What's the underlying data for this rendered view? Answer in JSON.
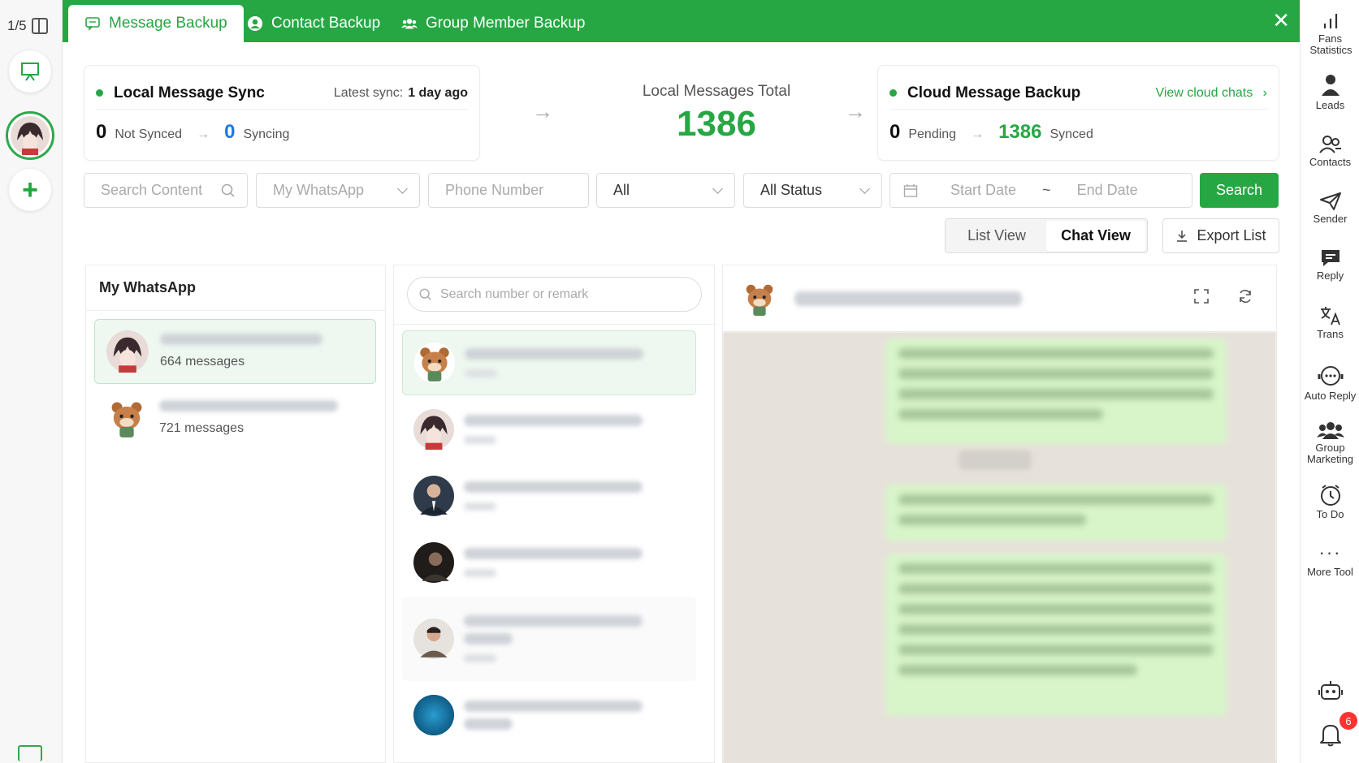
{
  "left_rail": {
    "page_count": "1/5"
  },
  "tabs": [
    {
      "label": "Message Backup",
      "active": true
    },
    {
      "label": "Contact Backup",
      "active": false
    },
    {
      "label": "Group Member Backup",
      "active": false
    }
  ],
  "local_sync": {
    "title": "Local Message Sync",
    "latest_label": "Latest sync:",
    "latest_value": "1 day ago",
    "not_synced_count": "0",
    "not_synced_label": "Not Synced",
    "syncing_count": "0",
    "syncing_label": "Syncing"
  },
  "total": {
    "label": "Local Messages Total",
    "value": "1386"
  },
  "cloud_backup": {
    "title": "Cloud Message Backup",
    "link": "View cloud chats",
    "pending_count": "0",
    "pending_label": "Pending",
    "synced_count": "1386",
    "synced_label": "Synced"
  },
  "filters": {
    "search_content_placeholder": "Search Content",
    "account_placeholder": "My WhatsApp",
    "phone_placeholder": "Phone Number",
    "type_value": "All",
    "status_value": "All Status",
    "start_date_placeholder": "Start Date",
    "date_separator": "~",
    "end_date_placeholder": "End Date",
    "search_button": "Search"
  },
  "views": {
    "list": "List View",
    "chat": "Chat View",
    "export": "Export List"
  },
  "accounts_panel": {
    "title": "My WhatsApp",
    "accounts": [
      {
        "count": "664 messages"
      },
      {
        "count": "721 messages"
      }
    ]
  },
  "chats_panel": {
    "search_placeholder": "Search number or remark"
  },
  "right_rail": {
    "items": [
      "Fans Statistics",
      "Leads",
      "Contacts",
      "Sender",
      "Reply",
      "Trans",
      "Auto Reply",
      "Group Marketing",
      "To Do",
      "More Tool"
    ],
    "notification_count": "6"
  },
  "colors": {
    "accent": "#26a743",
    "blue": "#1d77e8",
    "badge": "#ff3333"
  }
}
